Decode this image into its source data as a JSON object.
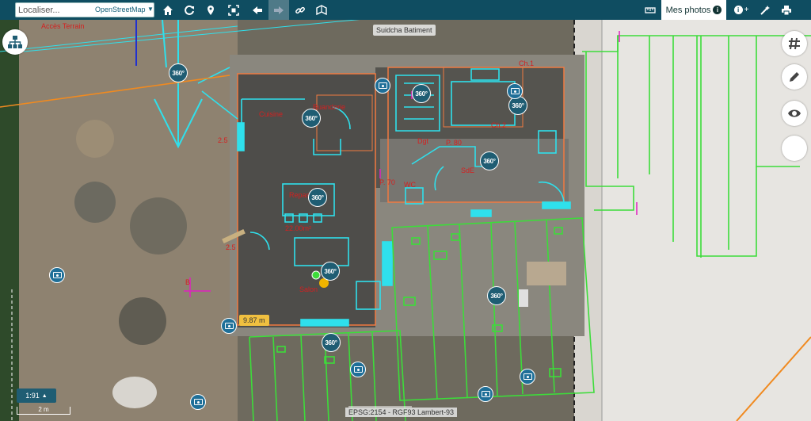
{
  "toolbar": {
    "search_placeholder": "Localiser...",
    "provider": "OpenStreetMap",
    "photos_tab": "Mes photos",
    "info_symbol": "i",
    "info_plus": "+",
    "buttons": [
      "home-icon",
      "refresh-icon",
      "location-pin-icon",
      "zoom-extent-icon",
      "arrow-left-icon",
      "arrow-right-icon",
      "link-icon",
      "map-book-icon",
      "ruler-icon",
      "info-plus-icon",
      "magic-wand-icon",
      "print-icon"
    ]
  },
  "map": {
    "top_label": "Suidcha Batiment",
    "labels": {
      "acces_terrain": "Accès Terrain",
      "cuisine": "Cuisine",
      "buanderie": "Buanderie",
      "repas": "Repas",
      "sejour": "22.00m²",
      "salon": "Salon",
      "dgt": "Dgt",
      "p80": "P. 80",
      "p70": "P. 70",
      "wc": "WC",
      "sde": "SdE",
      "ch2": "Ch.2",
      "ch1": "Ch.1",
      "b_mark": "B",
      "e_left": "2.5",
      "e_left2": "2.5"
    },
    "marker_360": "360°",
    "measure": "9.87 m",
    "zoom_level": "1:91",
    "scale": "2 m",
    "projection": "EPSG:2154 - RGF93 Lambert-93"
  },
  "colors": {
    "toolbar": "#0f4d61",
    "cyan_plan": "#2fe0ec",
    "green_plan": "#3ddc3a",
    "red_label": "#d42020"
  }
}
